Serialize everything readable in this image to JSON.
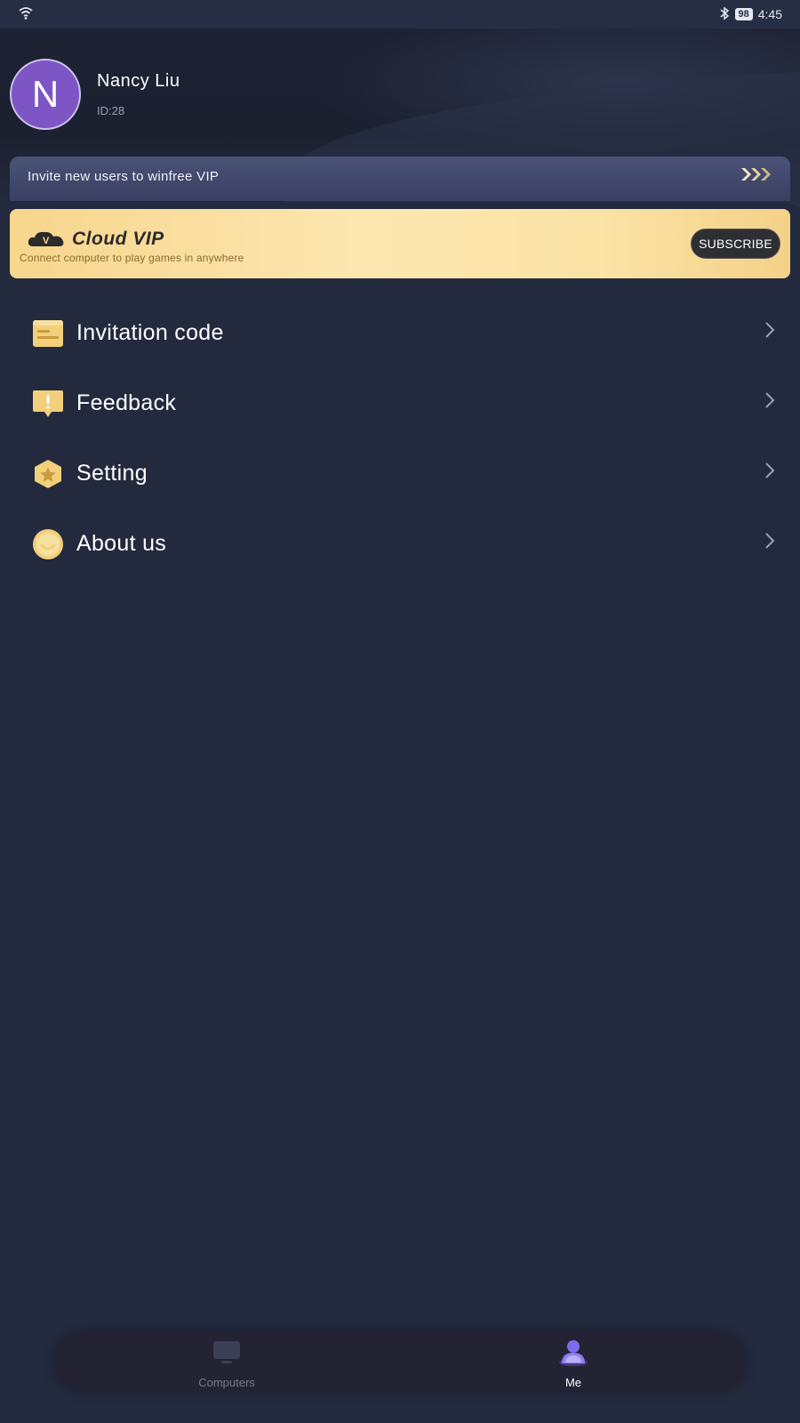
{
  "status_bar": {
    "time": "4:45",
    "battery": "98",
    "icons": [
      "wifi-icon",
      "bluetooth-icon",
      "battery-icon"
    ]
  },
  "profile": {
    "avatar_initial": "N",
    "name": "Nancy Liu",
    "id": "ID:28"
  },
  "invite_bar": {
    "text": "Invite new users to winfree VIP",
    "icon": "triple-chevron-right-icon"
  },
  "vip_card": {
    "title": "Cloud VIP",
    "subtitle": "Connect computer to play games in anywhere",
    "button": "SUBSCRIBE",
    "badge_letter": "V"
  },
  "menu": {
    "items": [
      {
        "label": "Invitation code",
        "icon": "ticket-icon"
      },
      {
        "label": "Feedback",
        "icon": "feedback-icon"
      },
      {
        "label": "Setting",
        "icon": "star-hexagon-icon"
      },
      {
        "label": "About us",
        "icon": "smiley-icon"
      }
    ]
  },
  "tabbar": {
    "tabs": [
      {
        "label": "Computers",
        "icon": "monitor-icon",
        "active": false
      },
      {
        "label": "Me",
        "icon": "person-icon",
        "active": true
      }
    ]
  },
  "colors": {
    "background": "#222a3e",
    "avatar": "#7d55c4",
    "vip_gold": "#fbe3a6",
    "accent_icon": "#f2cf7a",
    "tab_active": "#7d6cf0"
  }
}
